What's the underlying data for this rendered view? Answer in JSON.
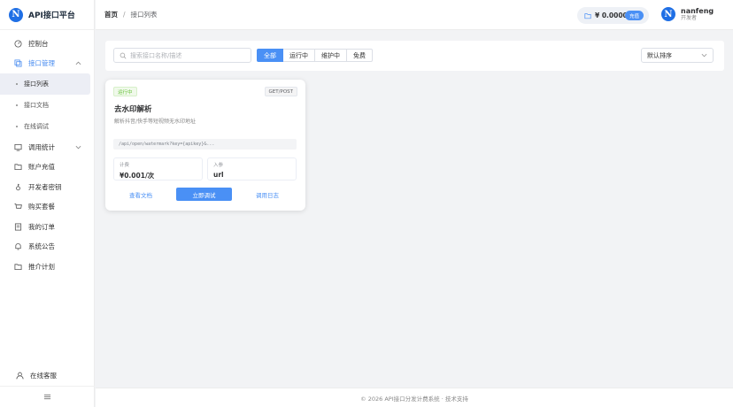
{
  "app": {
    "logo_letter": "N",
    "title": "API接口平台"
  },
  "sidebar": {
    "items": [
      {
        "label": "控制台",
        "icon": "dashboard-icon"
      },
      {
        "label": "接口管理",
        "icon": "api-icon",
        "expanded": true
      },
      {
        "label": "调用统计",
        "icon": "chart-icon"
      },
      {
        "label": "账户充值",
        "icon": "wallet-icon"
      },
      {
        "label": "开发者密钥",
        "icon": "key-icon"
      },
      {
        "label": "购买套餐",
        "icon": "cart-icon"
      },
      {
        "label": "我的订单",
        "icon": "order-icon"
      },
      {
        "label": "系统公告",
        "icon": "bell-icon"
      },
      {
        "label": "推介计划",
        "icon": "folder-icon"
      }
    ],
    "sub_items": [
      {
        "label": "接口列表",
        "active": true
      },
      {
        "label": "接口文档"
      },
      {
        "label": "在线调试"
      }
    ],
    "bottom": {
      "label": "在线客服",
      "icon": "user-icon"
    }
  },
  "header": {
    "breadcrumb_home": "首页",
    "breadcrumb_sep": "/",
    "breadcrumb_current": "接口列表",
    "balance": "¥ 0.0000",
    "recharge_label": "充值",
    "user_name": "nanfeng",
    "user_role": "开发者",
    "avatar_letter": "N"
  },
  "filters": {
    "search_placeholder": "搜索接口名称/描述",
    "tabs": [
      "全部",
      "运行中",
      "维护中",
      "免费"
    ],
    "active_tab": "全部",
    "sort_label": "默认排序"
  },
  "card": {
    "status": "运行中",
    "method": "GET/POST",
    "title": "去水印解析",
    "description": "解析抖音/快手等短视频无水印地址",
    "endpoint": "/api/open/watermark?key={apikey}&...",
    "price_label": "计费",
    "price_value": "¥0.001/次",
    "param_label": "入参",
    "param_value": "url",
    "doc_label": "查看文档",
    "debug_label": "立即调试",
    "log_label": "调用日志"
  },
  "footer": {
    "text": "© 2026 API接口分发计费系统 · 技术支持"
  },
  "colors": {
    "primary": "#4a90f5",
    "success": "#67c23a",
    "brand": "#1f6fe5"
  }
}
